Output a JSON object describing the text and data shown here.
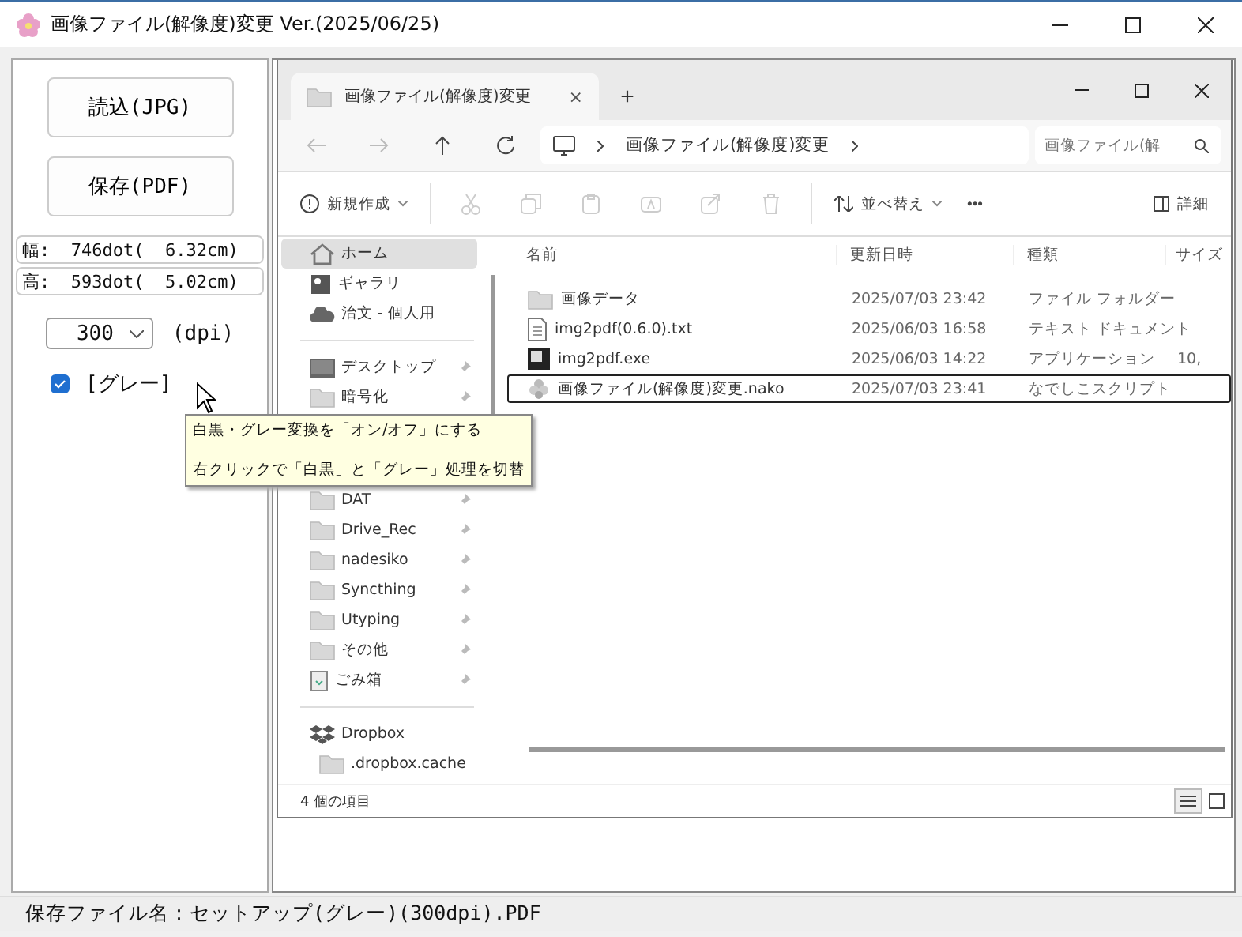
{
  "window": {
    "title": "画像ファイル(解像度)変更 Ver.(2025/06/25)"
  },
  "left_panel": {
    "buttons": [
      "読込(JPG)",
      "保存(PDF)"
    ],
    "info": [
      "幅:  746dot(  6.32cm)",
      "高:  593dot(  5.02cm)"
    ],
    "dpi": {
      "value": "300",
      "unit": "(dpi)"
    },
    "gray_checkbox": {
      "label": "[グレー]",
      "checked": true
    },
    "tooltip": [
      "白黒・グレー変換を「オン/オフ」にする",
      "右クリックで「白黒」と「グレー」処理を切替"
    ]
  },
  "preview": {
    "tab": {
      "title": "画像ファイル(解像度)変更",
      "close": "×",
      "new": "+"
    },
    "address": "画像ファイル(解像度)変更",
    "search_placeholder": "画像ファイル(解",
    "toolbar": {
      "new": "新規作成",
      "sort": "並べ替え",
      "more": "•••",
      "details": "詳細"
    },
    "nav_groups": [
      [
        {
          "label": "ホーム",
          "kind": "home",
          "selected": true,
          "pinned": false
        },
        {
          "label": "ギャラリ",
          "kind": "gallery",
          "selected": false,
          "pinned": false
        },
        {
          "label": "治文 - 個人用",
          "kind": "cloud",
          "selected": false,
          "pinned": false
        }
      ],
      [
        {
          "label": "デスクトップ",
          "kind": "desktop",
          "selected": false,
          "pinned": true
        },
        {
          "label": "暗号化",
          "kind": "folder",
          "selected": false,
          "pinned": true
        },
        {
          "label": "DAT",
          "kind": "folder",
          "selected": false,
          "pinned": true
        },
        {
          "label": "Drive_Rec",
          "kind": "folder",
          "selected": false,
          "pinned": true
        },
        {
          "label": "nadesiko",
          "kind": "folder",
          "selected": false,
          "pinned": true
        },
        {
          "label": "Syncthing",
          "kind": "folder",
          "selected": false,
          "pinned": true
        },
        {
          "label": "Utyping",
          "kind": "folder",
          "selected": false,
          "pinned": true
        },
        {
          "label": "その他",
          "kind": "folder",
          "selected": false,
          "pinned": true
        },
        {
          "label": "ごみ箱",
          "kind": "trash",
          "selected": false,
          "pinned": true
        }
      ],
      [
        {
          "label": "Dropbox",
          "kind": "dropbox",
          "selected": false,
          "pinned": false,
          "children": [
            {
              "label": ".dropbox.cache",
              "kind": "folder",
              "selected": false,
              "pinned": false
            }
          ]
        }
      ]
    ],
    "columns": [
      "名前",
      "更新日時",
      "種類",
      "サイズ"
    ],
    "files": [
      {
        "name": "画像データ",
        "kind": "folder",
        "modified": "2025/07/03 23:42",
        "type": "ファイル フォルダー",
        "selected": false
      },
      {
        "name": "img2pdf(0.6.0).txt",
        "kind": "text",
        "modified": "2025/06/03 16:58",
        "type": "テキスト ドキュメント",
        "selected": false
      },
      {
        "name": "img2pdf.exe",
        "kind": "app",
        "modified": "2025/06/03 14:22",
        "type": "アプリケーション",
        "size": "10,",
        "selected": false
      },
      {
        "name": "画像ファイル(解像度)変更.nako",
        "kind": "script",
        "modified": "2025/07/03 23:41",
        "type": "なでしこスクリプト",
        "selected": true
      }
    ],
    "status": "4 個の項目"
  },
  "status_bar": "保存ファイル名：セットアップ(グレー)(300dpi).PDF"
}
